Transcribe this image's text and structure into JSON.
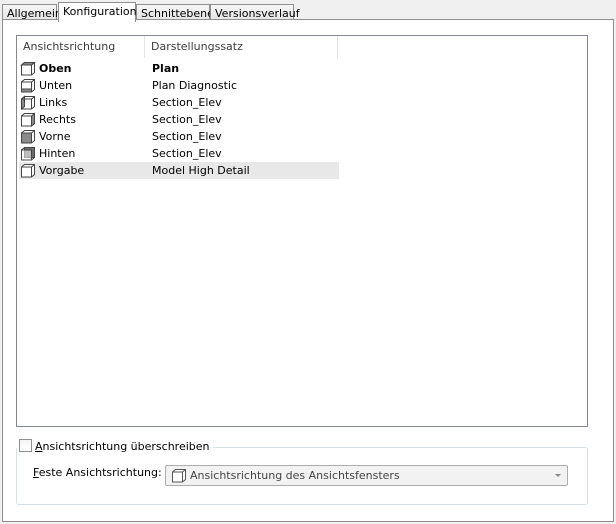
{
  "tabs": [
    {
      "label": "Allgemein",
      "active": false
    },
    {
      "label": "Konfiguration",
      "active": true
    },
    {
      "label": "Schnittebene",
      "active": false
    },
    {
      "label": "Versionsverlauf",
      "active": false
    }
  ],
  "list": {
    "columns": [
      "Ansichtsrichtung",
      "Darstellungssatz"
    ],
    "rows": [
      {
        "direction": "Oben",
        "style": "Plan",
        "icon": "cube-top-icon",
        "bold": true,
        "selected": false
      },
      {
        "direction": "Unten",
        "style": "Plan Diagnostic",
        "icon": "cube-bottom-icon",
        "bold": false,
        "selected": false
      },
      {
        "direction": "Links",
        "style": "Section_Elev",
        "icon": "cube-left-icon",
        "bold": false,
        "selected": false
      },
      {
        "direction": "Rechts",
        "style": "Section_Elev",
        "icon": "cube-right-icon",
        "bold": false,
        "selected": false
      },
      {
        "direction": "Vorne",
        "style": "Section_Elev",
        "icon": "cube-front-icon",
        "bold": false,
        "selected": false
      },
      {
        "direction": "Hinten",
        "style": "Section_Elev",
        "icon": "cube-back-icon",
        "bold": false,
        "selected": false
      },
      {
        "direction": "Vorgabe",
        "style": "Model High Detail",
        "icon": "cube-default-icon",
        "bold": false,
        "selected": true
      }
    ]
  },
  "override": {
    "checkbox_mnemonic": "A",
    "checkbox_label_rest": "nsichtsrichtung überschreiben",
    "checked": false,
    "fixed_label_mnemonic": "F",
    "fixed_label_rest": "este Ansichtsrichtung:",
    "fixed_value": "Ansichtsrichtung des Ansichtsfensters"
  }
}
